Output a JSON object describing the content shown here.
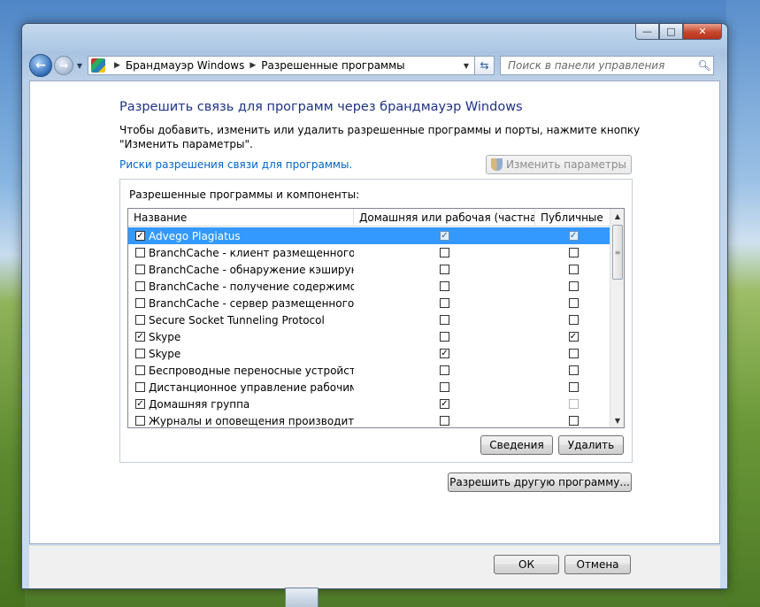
{
  "window": {
    "caption_buttons": {
      "minimize": "—",
      "maximize": "□",
      "close": "✕"
    }
  },
  "nav": {
    "back_glyph": "←",
    "forward_glyph": "→",
    "breadcrumb": [
      "Брандмауэр Windows",
      "Разрешенные программы"
    ],
    "search_placeholder": "Поиск в панели управления"
  },
  "page": {
    "title": "Разрешить связь для программ через брандмауэр Windows",
    "description": "Чтобы добавить, изменить или удалить разрешенные программы и порты, нажмите кнопку \"Изменить параметры\".",
    "risk_link": "Риски разрешения связи для программы.",
    "change_settings_label": "Изменить параметры"
  },
  "group": {
    "label": "Разрешенные программы и компоненты:",
    "columns": [
      "Название",
      "Домашняя или рабочая (частная)",
      "Публичные"
    ],
    "rows": [
      {
        "name": "Advego Plagiatus",
        "enabled": true,
        "home": true,
        "public": true,
        "selected": true
      },
      {
        "name": "BranchCache - клиент размещенного кэ...",
        "enabled": false,
        "home": false,
        "public": false
      },
      {
        "name": "BranchCache - обнаружение кэширующ...",
        "enabled": false,
        "home": false,
        "public": false
      },
      {
        "name": "BranchCache - получение содержимого ...",
        "enabled": false,
        "home": false,
        "public": false
      },
      {
        "name": "BranchCache - сервер размещенного кэ...",
        "enabled": false,
        "home": false,
        "public": false
      },
      {
        "name": "Secure Socket Tunneling Protocol",
        "enabled": false,
        "home": false,
        "public": false
      },
      {
        "name": "Skype",
        "enabled": true,
        "home": false,
        "public": true
      },
      {
        "name": "Skype",
        "enabled": false,
        "home": true,
        "public": false
      },
      {
        "name": "Беспроводные переносные устройства",
        "enabled": false,
        "home": false,
        "public": false
      },
      {
        "name": "Дистанционное управление рабочим ст...",
        "enabled": false,
        "home": false,
        "public": false
      },
      {
        "name": "Домашняя группа",
        "enabled": true,
        "home": true,
        "public": false,
        "public_dim": true
      },
      {
        "name": "Журналы и оповещения производитель...",
        "enabled": false,
        "home": false,
        "public": false
      }
    ],
    "details_label": "Сведения",
    "delete_label": "Удалить"
  },
  "allow_other_label": "Разрешить другую программу...",
  "footer": {
    "ok_label": "ОК",
    "cancel_label": "Отмена"
  }
}
